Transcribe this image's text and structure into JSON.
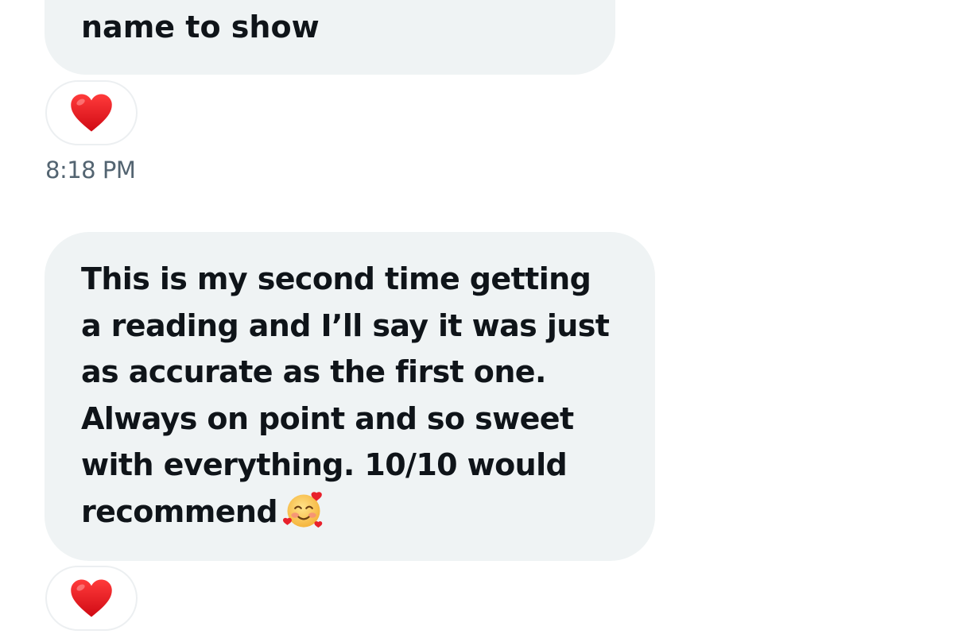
{
  "messages": [
    {
      "text": "name to show",
      "reaction": {
        "icon": "red-heart-icon",
        "color": "#e0141e"
      }
    },
    {
      "timestamp": "8:18 PM",
      "text": "This is my second time getting\na reading and I’ll say it was just\nas accurate as the first one.\nAlways on point and so sweet\nwith everything. 10/10 would\nrecommend",
      "trailing_emoji": "smiling-face-with-hearts-icon",
      "reaction": {
        "icon": "red-heart-icon",
        "color": "#e0141e"
      }
    }
  ],
  "colors": {
    "bubble_background": "#eff3f4",
    "message_text": "#0f1419",
    "timestamp_text": "#536471"
  }
}
